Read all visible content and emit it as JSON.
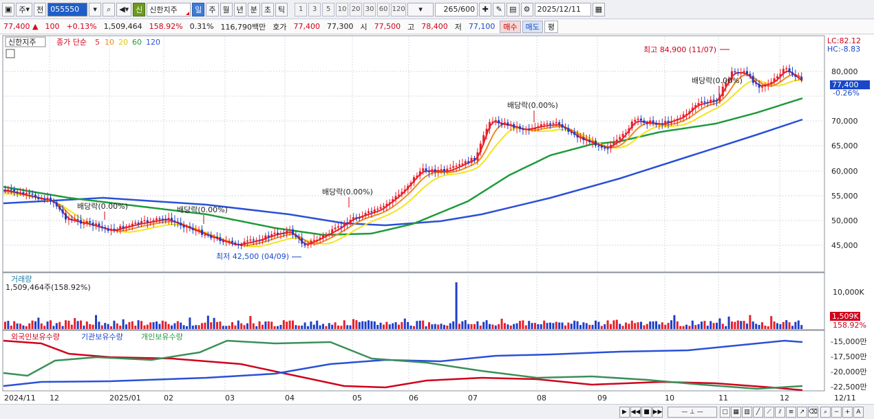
{
  "toolbar": {
    "period_primary": "주",
    "prev_label": "전",
    "code": "055550",
    "badge": "신",
    "stock_name": "신한지주",
    "periods": [
      "일",
      "주",
      "월",
      "년",
      "분",
      "초",
      "틱"
    ],
    "selected_period": "일",
    "numbers": [
      "1",
      "3",
      "5",
      "10",
      "20",
      "30",
      "60",
      "120"
    ],
    "count": "265/600",
    "date": "2025/12/11"
  },
  "quote": {
    "price": "77,400",
    "change": "100",
    "change_pct": "+0.13%",
    "volume": "1,509,464",
    "volume_ratio": "158.92%",
    "turnover": "0.31%",
    "amount": "116,790백만",
    "ask_label": "호가",
    "ask": "77,400",
    "bid": "77,300",
    "open_label": "시",
    "open": "77,500",
    "high_label": "고",
    "high": "78,400",
    "low_label": "저",
    "low": "77,100",
    "buy_label": "매수",
    "sell_label": "매도",
    "eval_label": "평"
  },
  "price_panel": {
    "stock_tag": "신한지주",
    "legend_prefix": "종가 단순",
    "ma_legend": [
      "5",
      "10",
      "20",
      "60",
      "120"
    ],
    "lc": "LC:82.12",
    "hc": "HC:-8.83",
    "current_price": "77,400",
    "current_pct": "-0.26%",
    "y_ticks": [
      "80,000",
      "75,000",
      "70,000",
      "65,000",
      "60,000",
      "55,000",
      "50,000",
      "45,000"
    ],
    "annotations": {
      "high": "최고 84,900 (11/07)",
      "low": "최저 42,500 (04/09)",
      "div1": "배당락(0.00%)",
      "div2": "배당락(0.00%)",
      "div3": "배당락(0.00%)",
      "div4": "배당락(0.00%)",
      "div5": "배당락(0.00%)"
    }
  },
  "volume_panel": {
    "title": "거래량",
    "value": "1,509,464주(158.92%)",
    "y_tick": "10,000K",
    "current": "1,509K",
    "current_pct": "158.92%"
  },
  "holdings_panel": {
    "foreign": "외국인보유수량",
    "institution": "기관보유수량",
    "individual": "개인보유수량",
    "y_ticks": [
      "-15,000만",
      "-17,500만",
      "-20,000만",
      "-22,500만"
    ]
  },
  "x_axis": [
    "2024/11",
    "12",
    "2025/01",
    "02",
    "03",
    "04",
    "05",
    "06",
    "07",
    "08",
    "09",
    "10",
    "11",
    "12",
    "12/11"
  ],
  "colors": {
    "ma5": "#e8202a",
    "ma10": "#f08a1c",
    "ma20": "#f4e41a",
    "ma60": "#1f9a3a",
    "ma120": "#2a50d6",
    "up": "#e8202a",
    "down": "#1e3fc8"
  },
  "chart_data": {
    "type": "candlestick",
    "ylim": [
      40000,
      87000
    ],
    "markers": {
      "high": 84900,
      "low": 42500
    },
    "last_price": 77400,
    "ma": [
      "5",
      "10",
      "20",
      "60",
      "120"
    ]
  }
}
